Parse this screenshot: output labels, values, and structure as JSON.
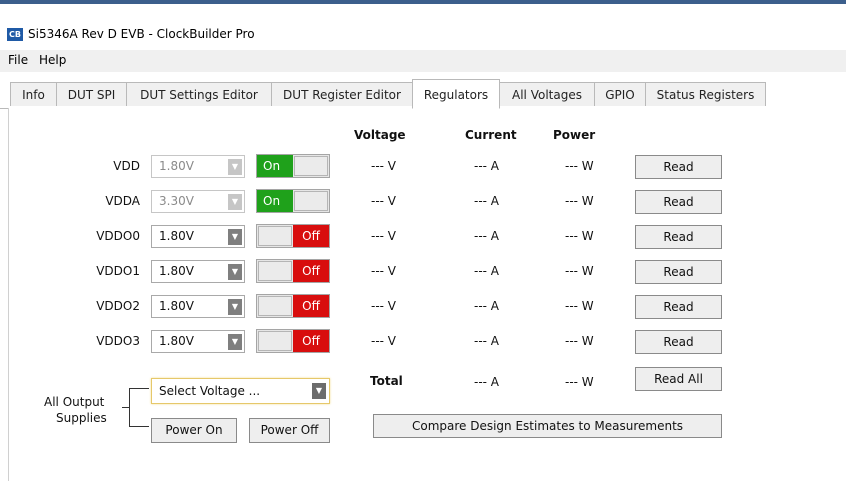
{
  "window": {
    "title": "Si5346A Rev D EVB - ClockBuilder Pro",
    "icon": "CB"
  },
  "menu": [
    "File",
    "Help"
  ],
  "tabs": [
    {
      "label": "Info",
      "active": false
    },
    {
      "label": "DUT SPI",
      "active": false
    },
    {
      "label": "DUT Settings Editor",
      "active": false
    },
    {
      "label": "DUT Register Editor",
      "active": false
    },
    {
      "label": "Regulators",
      "active": true
    },
    {
      "label": "All Voltages",
      "active": false
    },
    {
      "label": "GPIO",
      "active": false
    },
    {
      "label": "Status Registers",
      "active": false
    }
  ],
  "columns": {
    "voltage": "Voltage",
    "current": "Current",
    "power": "Power"
  },
  "rows": [
    {
      "label": "VDD",
      "select": "1.80V",
      "enabled": false,
      "state": "On",
      "voltage": "--- V",
      "current": "--- A",
      "power": "--- W",
      "button": "Read"
    },
    {
      "label": "VDDA",
      "select": "3.30V",
      "enabled": false,
      "state": "On",
      "voltage": "--- V",
      "current": "--- A",
      "power": "--- W",
      "button": "Read"
    },
    {
      "label": "VDDO0",
      "select": "1.80V",
      "enabled": true,
      "state": "Off",
      "voltage": "--- V",
      "current": "--- A",
      "power": "--- W",
      "button": "Read"
    },
    {
      "label": "VDDO1",
      "select": "1.80V",
      "enabled": true,
      "state": "Off",
      "voltage": "--- V",
      "current": "--- A",
      "power": "--- W",
      "button": "Read"
    },
    {
      "label": "VDDO2",
      "select": "1.80V",
      "enabled": true,
      "state": "Off",
      "voltage": "--- V",
      "current": "--- A",
      "power": "--- W",
      "button": "Read"
    },
    {
      "label": "VDDO3",
      "select": "1.80V",
      "enabled": true,
      "state": "Off",
      "voltage": "--- V",
      "current": "--- A",
      "power": "--- W",
      "button": "Read"
    }
  ],
  "total": {
    "label": "Total",
    "current": "--- A",
    "power": "--- W",
    "button": "Read All"
  },
  "supplies": {
    "label_line1": "All Output",
    "label_line2": "Supplies",
    "select": "Select Voltage ...",
    "power_on": "Power On",
    "power_off": "Power Off"
  },
  "compare_button": "Compare Design Estimates to Measurements",
  "colors": {
    "on": "#1fa11b",
    "off": "#d80e0e",
    "accent": "#1f5aa6"
  }
}
